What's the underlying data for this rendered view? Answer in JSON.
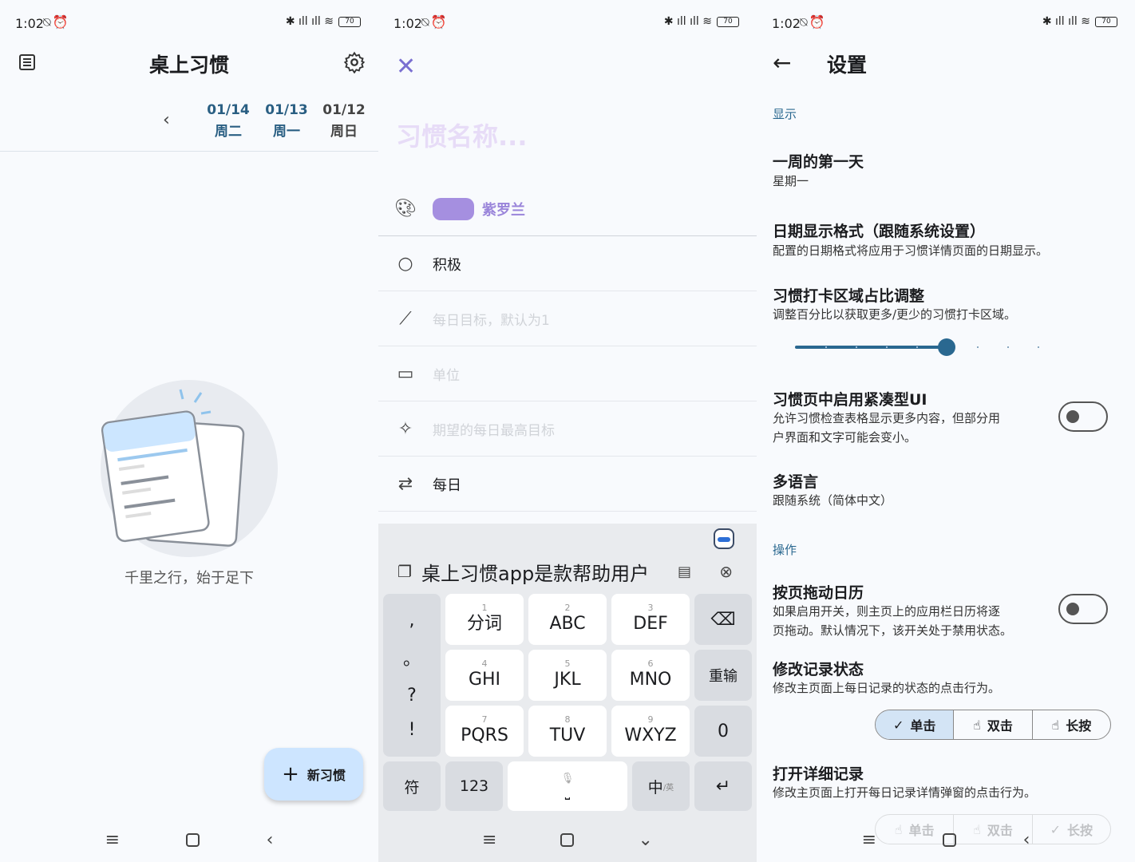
{
  "status": {
    "time": "1:02",
    "battery": "70"
  },
  "panel1": {
    "title": "桌上习惯",
    "dates": [
      {
        "date": "01/14",
        "weekday": "周二"
      },
      {
        "date": "01/13",
        "weekday": "周一"
      },
      {
        "date": "01/12",
        "weekday": "周日"
      }
    ],
    "empty_text": "千里之行，始于足下",
    "fab_label": "新习惯"
  },
  "panel2": {
    "name_placeholder": "习惯名称...",
    "color_label": "紫罗兰",
    "type_label": "积极",
    "daily_target_placeholder": "每日目标，默认为1",
    "unit_placeholder": "单位",
    "max_target_placeholder": "期望的每日最高目标",
    "frequency_label": "每日",
    "keyboard": {
      "candidate": "桌上习惯app是款帮助用户",
      "keys_row1": [
        {
          "num": "1",
          "label": "分词"
        },
        {
          "num": "2",
          "label": "ABC"
        },
        {
          "num": "3",
          "label": "DEF"
        }
      ],
      "keys_row2": [
        {
          "num": "4",
          "label": "GHI"
        },
        {
          "num": "5",
          "label": "JKL"
        },
        {
          "num": "6",
          "label": "MNO"
        }
      ],
      "keys_row3": [
        {
          "num": "7",
          "label": "PQRS"
        },
        {
          "num": "8",
          "label": "TUV"
        },
        {
          "num": "9",
          "label": "WXYZ"
        }
      ],
      "punct": [
        ",",
        "。",
        "?",
        "!"
      ],
      "retype": "重输",
      "zero": "0",
      "sym": "符",
      "num123": "123",
      "lang": "中",
      "lang_small": "/英"
    }
  },
  "panel3": {
    "title": "设置",
    "section_display": "显示",
    "first_day_title": "一周的第一天",
    "first_day_value": "星期一",
    "date_format_title": "日期显示格式（跟随系统设置）",
    "date_format_desc": "配置的日期格式将应用于习惯详情页面的日期显示。",
    "area_title": "习惯打卡区域占比调整",
    "area_desc": "调整百分比以获取更多/更少的习惯打卡区域。",
    "area_slider_fraction": 0.5,
    "compact_title": "习惯页中启用紧凑型UI",
    "compact_desc1": "允许习惯检查表格显示更多内容，但部分用",
    "compact_desc2": "户界面和文字可能会变小。",
    "lang_title": "多语言",
    "lang_value": "跟随系统（简体中文）",
    "section_ops": "操作",
    "drag_title": "按页拖动日历",
    "drag_desc1": "如果启用开关，则主页上的应用栏日历将逐",
    "drag_desc2": "页拖动。默认情况下，该开关处于禁用状态。",
    "record_title": "修改记录状态",
    "record_desc": "修改主页面上每日记录的状态的点击行为。",
    "seg_options": [
      "单击",
      "双击",
      "长按"
    ],
    "detail_title": "打开详细记录",
    "detail_desc": "修改主页面上打开每日记录详情弹窗的点击行为。"
  }
}
